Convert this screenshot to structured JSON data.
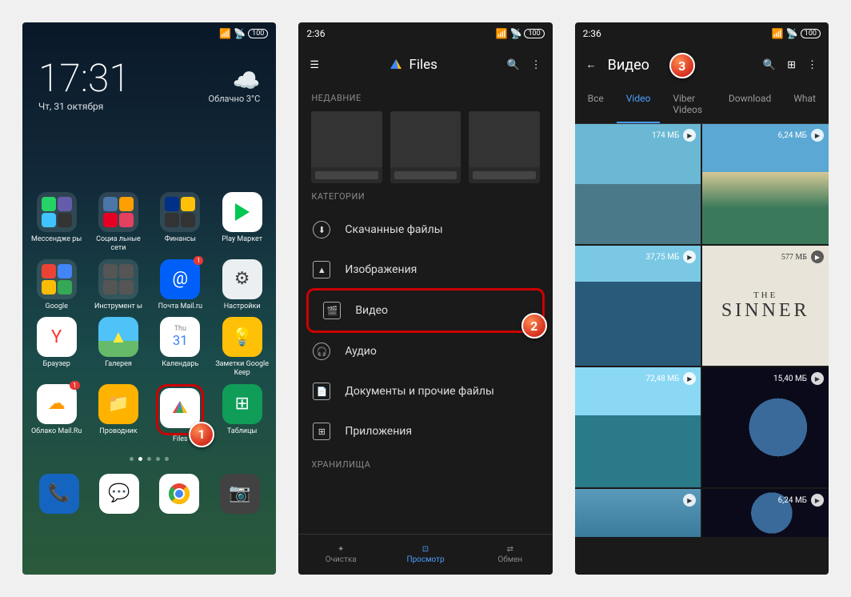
{
  "status": {
    "time_s1": "",
    "time_s2": "2:36",
    "time_s3": "2:36",
    "battery": "100"
  },
  "s1": {
    "time": "17:31",
    "date": "Чт, 31 октября",
    "weather": "Облачно 3°C",
    "apps": [
      {
        "label": "Мессендже\nры"
      },
      {
        "label": "Социа\nльные сети"
      },
      {
        "label": "Финансы"
      },
      {
        "label": "Play Маркет"
      },
      {
        "label": "Google"
      },
      {
        "label": "Инструмент\nы"
      },
      {
        "label": "Почта\nMail.ru"
      },
      {
        "label": "Настройки"
      },
      {
        "label": "Браузер"
      },
      {
        "label": "Галерея"
      },
      {
        "label": "Календарь"
      },
      {
        "label": "Заметки\nGoogle Keep"
      },
      {
        "label": "Облако\nMail.Ru"
      },
      {
        "label": "Проводник"
      },
      {
        "label": "Files"
      },
      {
        "label": "Таблицы"
      }
    ],
    "cal_day": "31",
    "cal_dow": "Thu"
  },
  "s2": {
    "title": "Files",
    "recent": "НЕДАВНИЕ",
    "categories": "КАТЕГОРИИ",
    "cats": [
      {
        "label": "Скачанные файлы"
      },
      {
        "label": "Изображения"
      },
      {
        "label": "Видео"
      },
      {
        "label": "Аудио"
      },
      {
        "label": "Документы и прочие файлы"
      },
      {
        "label": "Приложения"
      }
    ],
    "storage": "ХРАНИЛИЩА",
    "nav": [
      {
        "label": "Очистка"
      },
      {
        "label": "Просмотр"
      },
      {
        "label": "Обмен"
      }
    ]
  },
  "s3": {
    "title": "Видео",
    "tabs": [
      {
        "label": "Все"
      },
      {
        "label": "Video"
      },
      {
        "label": "Viber Videos"
      },
      {
        "label": "Download"
      },
      {
        "label": "What"
      }
    ],
    "videos": [
      {
        "size": "174 МБ"
      },
      {
        "size": "6,24 МБ"
      },
      {
        "size": "37,75 МБ"
      },
      {
        "size": "577 МБ"
      },
      {
        "size": "72,48 МБ"
      },
      {
        "size": "15,40 МБ"
      },
      {
        "size": ""
      },
      {
        "size": "6,24 МБ"
      }
    ],
    "sinner_the": "THE",
    "sinner_title": "SINNER"
  },
  "markers": {
    "m1": "1",
    "m2": "2",
    "m3": "3"
  }
}
